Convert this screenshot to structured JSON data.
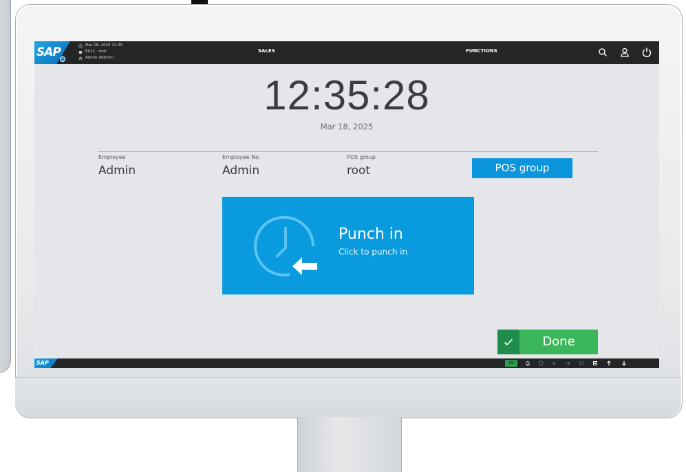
{
  "header": {
    "brand": "SAP",
    "session": {
      "datetime": "Mar 18, 2025 12:35",
      "store": "E012 - root",
      "user": "Admin (Admin)"
    },
    "nav": {
      "sales": "SALES",
      "functions": "FUNCTIONS"
    },
    "icons": [
      "search-icon",
      "user-icon",
      "power-icon"
    ]
  },
  "clock": {
    "time": "12:35:28",
    "date": "Mar 18, 2025"
  },
  "info": {
    "employee_label": "Employee",
    "employee_value": "Admin",
    "employee_no_label": "Employee No.",
    "employee_no_value": "Admin",
    "pos_group_label": "POS group",
    "pos_group_value": "root",
    "pos_group_button": "POS group"
  },
  "punch": {
    "title": "Punch in",
    "subtitle": "Click to punch in"
  },
  "actions": {
    "done": "Done"
  },
  "statusbar": {
    "brand": "SAP",
    "queue_count": "99",
    "icons": [
      "notification-icon",
      "sync-icon",
      "download-icon",
      "transfer-icon",
      "printer-icon",
      "cash-drawer-icon",
      "arrow-up-icon",
      "arrow-down-icon"
    ]
  },
  "colors": {
    "accent": "#0a9bde",
    "done_green": "#3bb65a",
    "topbar": "#232527",
    "background": "#e4e6e9"
  }
}
